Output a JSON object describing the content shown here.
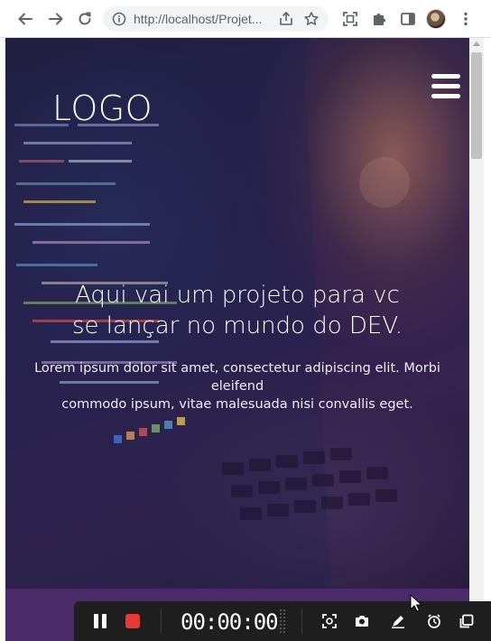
{
  "browser": {
    "url": "http://localhost/Projet...",
    "icons": [
      "back-arrow-icon",
      "forward-arrow-icon",
      "reload-icon",
      "info-icon",
      "share-icon",
      "bookmark-star-icon",
      "screen-capture-icon",
      "extensions-puzzle-icon",
      "side-panel-icon",
      "profile-avatar",
      "more-menu-icon"
    ]
  },
  "page": {
    "logo": "LOGO",
    "menu_icon": "hamburger-menu-icon",
    "headline_line1": "Aqui vai um projeto para vc",
    "headline_line2": "se lançar no mundo do DEV.",
    "subtitle_line1": "Lorem ipsum dolor sit amet, consectetur adipiscing elit. Morbi eleifend",
    "subtitle_line2": "commodo ipsum, vitae malesuada nisi convallis eget.",
    "band_color": "#4a2a6a"
  },
  "recorder": {
    "time": "00:00:00",
    "icons": [
      "pause-icon",
      "stop-icon",
      "region-capture-icon",
      "camera-icon",
      "pen-icon",
      "timer-icon",
      "window-icon"
    ],
    "stop_color": "#e53935"
  }
}
